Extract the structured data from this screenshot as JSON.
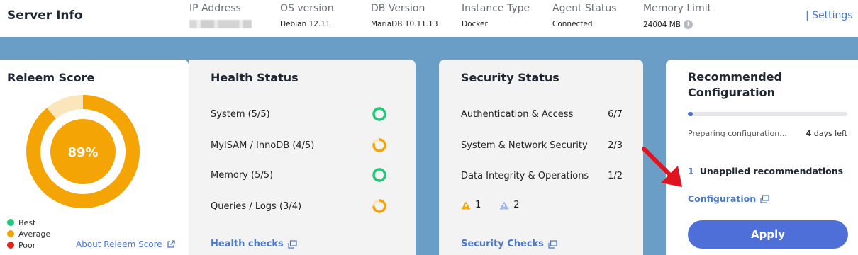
{
  "header": {
    "title": "Server Info",
    "fields": [
      {
        "label": "IP Address",
        "value": ""
      },
      {
        "label": "OS version",
        "value": "Debian 12.11"
      },
      {
        "label": "DB Version",
        "value": "MariaDB 10.11.13"
      },
      {
        "label": "Instance Type",
        "value": "Docker"
      },
      {
        "label": "Agent Status",
        "value": "Connected"
      },
      {
        "label": "Memory Limit",
        "value": "24004 MB"
      }
    ],
    "info_icon": "i",
    "settings_label": "| Settings"
  },
  "score": {
    "title": "Releem Score",
    "value_text": "89%",
    "fraction": 0.89,
    "ring_color": "#f5a406",
    "track_color": "#fbe6bc",
    "legend": [
      {
        "label": "Best",
        "color": "#22c77a"
      },
      {
        "label": "Average",
        "color": "#f5a406"
      },
      {
        "label": "Poor",
        "color": "#e0241b"
      }
    ],
    "about_link": "About Releem Score"
  },
  "health": {
    "title": "Health Status",
    "items": [
      {
        "label": "System (5/5)",
        "status": "best",
        "color": "#22c77a",
        "fraction": 1.0
      },
      {
        "label": "MyISAM / InnoDB (4/5)",
        "status": "average",
        "color": "#f5a406",
        "fraction": 0.8
      },
      {
        "label": "Memory (5/5)",
        "status": "best",
        "color": "#22c77a",
        "fraction": 1.0
      },
      {
        "label": "Queries / Logs (3/4)",
        "status": "average",
        "color": "#f5a406",
        "fraction": 0.75
      }
    ],
    "link": "Health checks"
  },
  "security": {
    "title": "Security Status",
    "items": [
      {
        "label": "Authentication & Access",
        "value": "6/7"
      },
      {
        "label": "System & Network Security",
        "value": "2/3"
      },
      {
        "label": "Data Integrity & Operations",
        "value": "1/2"
      }
    ],
    "warnings": [
      {
        "icon": "warning-orange-icon",
        "color": "#f5a406",
        "count": "1"
      },
      {
        "icon": "warning-blue-icon",
        "color": "#9fb3e8",
        "count": "2"
      }
    ],
    "link": "Security Checks"
  },
  "recommended": {
    "title": "Recommended Configuration",
    "progress": 0.03,
    "preparing_text": "Preparing configuration...",
    "days_number": "4",
    "days_text": "days left",
    "unapplied_count": "1",
    "unapplied_label": "Unapplied recommendations",
    "config_link": "Configuration",
    "apply_label": "Apply"
  }
}
